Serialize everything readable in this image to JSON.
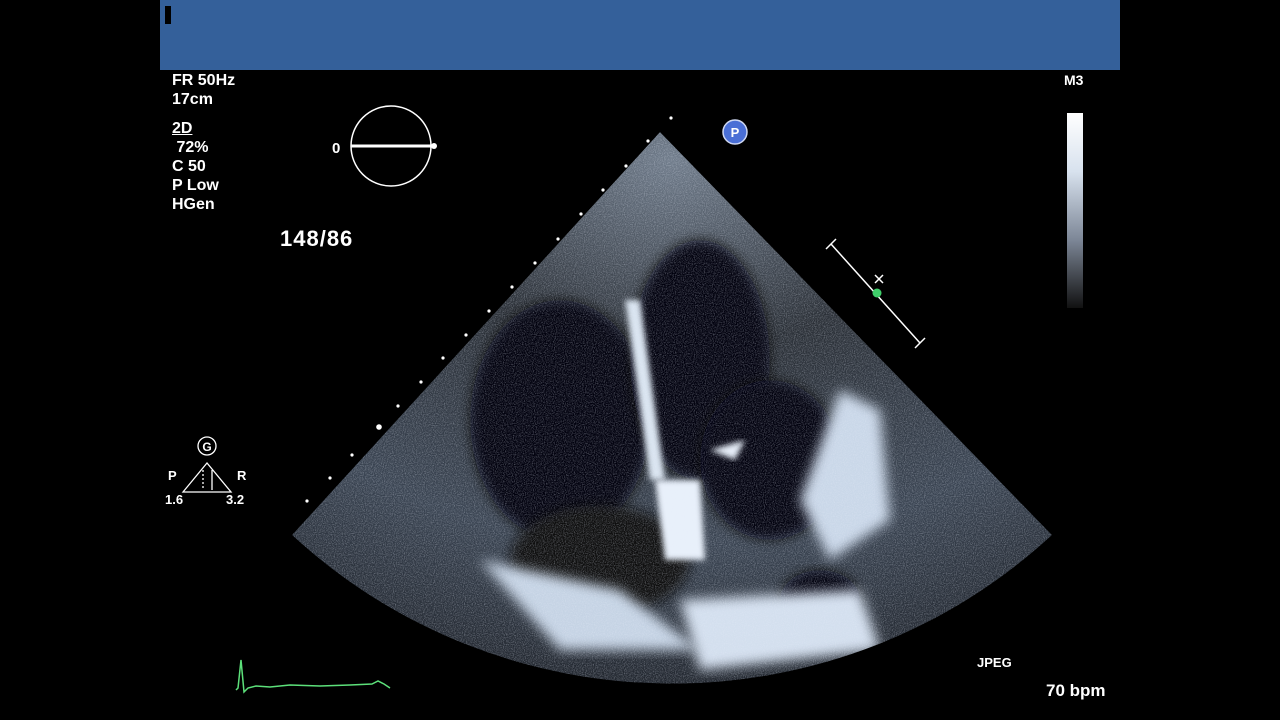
{
  "header": {
    "bar_color": "#34609a"
  },
  "acquisition": {
    "frame_rate": "FR 50Hz",
    "depth": "17cm",
    "mode": "2D",
    "gain": " 72%",
    "compression": "C 50",
    "power": "P Low",
    "frequency": "HGen"
  },
  "blood_pressure": "148/86",
  "probe_angle": "0",
  "probe_marker": "P",
  "probe_model": "M3",
  "gain_indicator": {
    "letter": "G",
    "left_label": "P",
    "right_label": "R",
    "left_value": "1.6",
    "right_value": "3.2"
  },
  "export_format": "JPEG",
  "heart_rate": "70 bpm",
  "icons": [
    "probe-orientation-circle-icon",
    "probe-marker-icon",
    "gain-triangle-icon",
    "ecg-trace-icon",
    "depth-scale-icon",
    "grayscale-bar-icon"
  ],
  "colors": {
    "marker": "#4a6fd6",
    "ecg": "#5ce07a",
    "caliper_dot": "#3fcf6a"
  }
}
